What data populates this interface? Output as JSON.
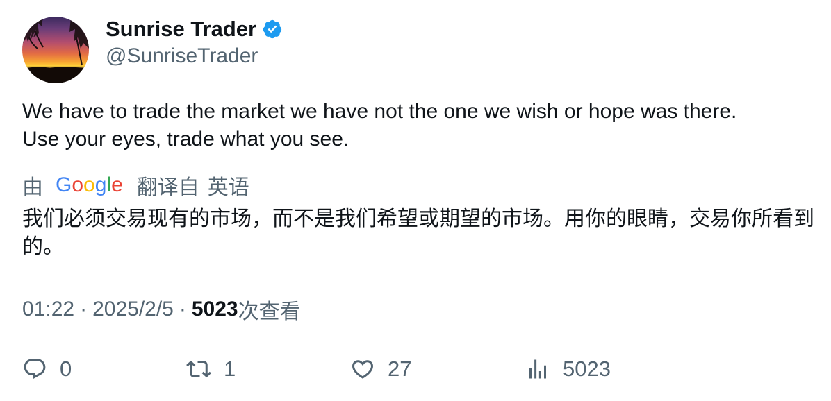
{
  "author": {
    "display_name": "Sunrise Trader",
    "handle": "@SunriseTrader",
    "verified": true,
    "verified_color": "#1d9bf0"
  },
  "tweet": {
    "text_line1": "We have to trade the market we have not the one we wish or hope was there.",
    "text_line2": "Use your eyes, trade what you see."
  },
  "translation": {
    "by_label": "由",
    "provider_letters": [
      "G",
      "o",
      "o",
      "g",
      "l",
      "e"
    ],
    "from_label": "翻译自",
    "source_language": "英语",
    "translated_text": "我们必须交易现有的市场，而不是我们希望或期望的市场。用你的眼睛，交易你所看到的。"
  },
  "meta": {
    "time": "01:22",
    "date": "2025/2/5",
    "separator": "·",
    "views_count": "5023",
    "views_label": "次查看"
  },
  "actions": {
    "replies": "0",
    "retweets": "1",
    "likes": "27",
    "views": "5023"
  },
  "icons": {
    "reply": "reply-icon",
    "retweet": "retweet-icon",
    "like": "heart-icon",
    "views": "views-chart-icon",
    "verified": "verified-badge-icon"
  }
}
